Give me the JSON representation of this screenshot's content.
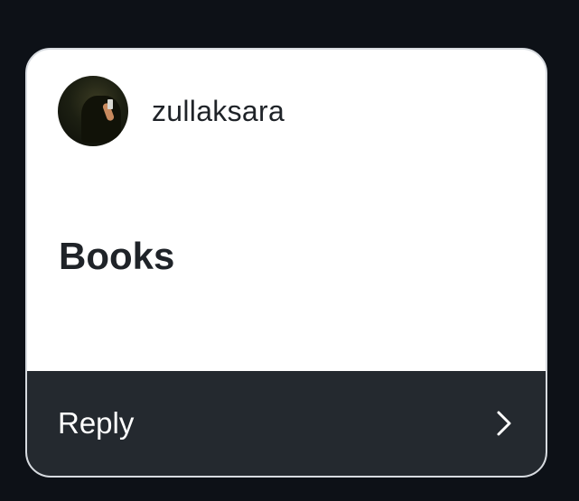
{
  "post": {
    "username": "zullaksara",
    "title": "Books"
  },
  "footer": {
    "reply_label": "Reply",
    "chevron_icon": "chevron-right-icon"
  },
  "colors": {
    "page_background": "#0d1117",
    "card_background": "#ffffff",
    "footer_background": "#24292f",
    "text_dark": "#1f2328",
    "text_light": "#ffffff"
  }
}
